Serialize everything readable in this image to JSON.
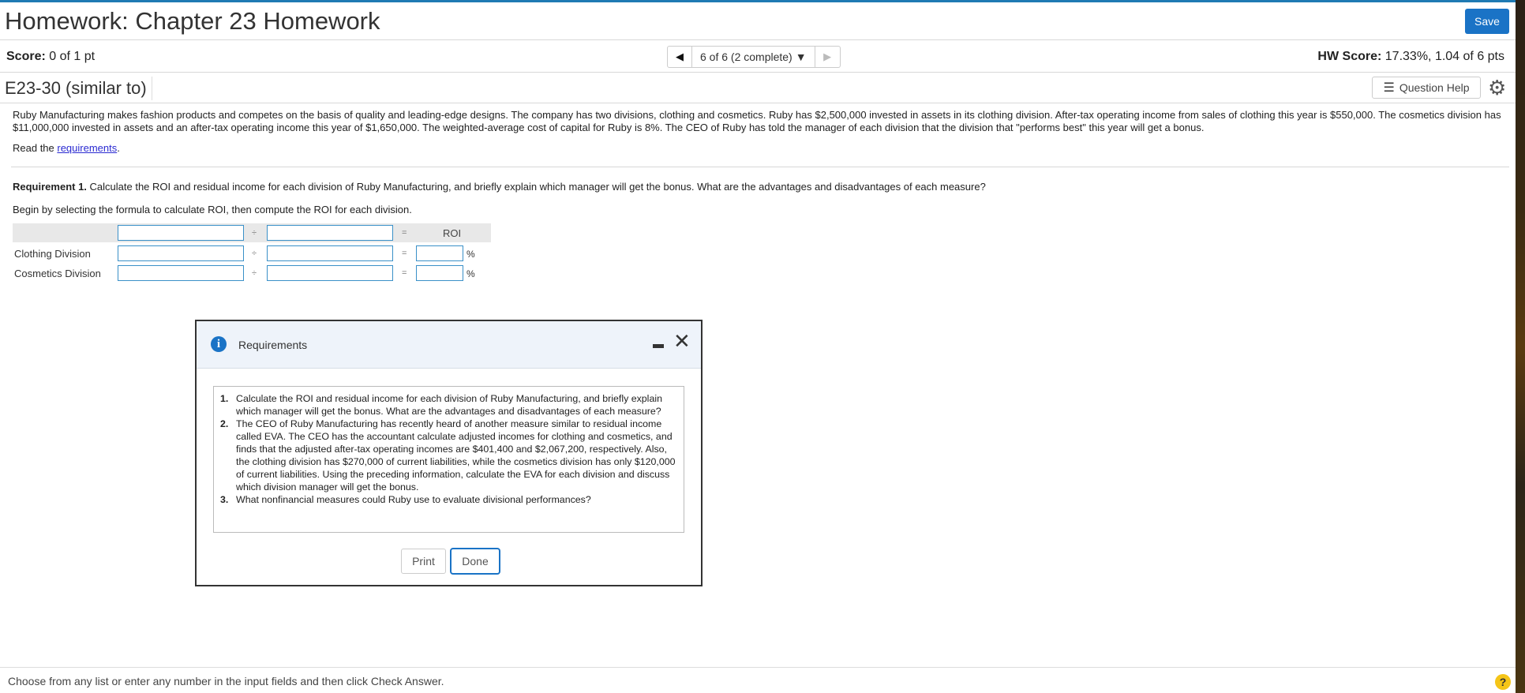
{
  "header": {
    "title": "Homework: Chapter 23 Homework",
    "save_label": "Save"
  },
  "scorebar": {
    "score_label": "Score:",
    "score_value": "0 of 1 pt",
    "nav_position": "6 of 6 (2 complete)",
    "hw_score_label": "HW Score:",
    "hw_score_value": "17.33%, 1.04 of 6 pts"
  },
  "question": {
    "id": "E23-30 (similar to)",
    "help_label": "Question Help"
  },
  "problem": {
    "text": "Ruby Manufacturing makes fashion products and competes on the basis of quality and leading-edge designs. The company has two divisions, clothing and cosmetics. Ruby has $2,500,000 invested in assets in its clothing division. After-tax operating income from sales of clothing this year is $550,000. The cosmetics division has $11,000,000 invested in assets and an after-tax operating income this year of $1,650,000. The weighted-average cost of capital for Ruby is 8%. The CEO of Ruby has told the manager of each division that the division that \"performs best\" this year will get a bonus.",
    "read_prefix": "Read the ",
    "read_link": "requirements",
    "read_suffix": "."
  },
  "requirement1": {
    "label": "Requirement 1.",
    "text": " Calculate the ROI and residual income for each division of Ruby Manufacturing, and briefly explain which manager will get the bonus. What are the advantages and disadvantages of each measure?",
    "begin": "Begin by selecting the formula to calculate ROI, then compute the ROI for each division."
  },
  "grid": {
    "divide_symbol": "÷",
    "equals_symbol": "=",
    "roi_header": "ROI",
    "percent": "%",
    "rows": [
      {
        "label": "Clothing Division"
      },
      {
        "label": "Cosmetics Division"
      }
    ]
  },
  "modal": {
    "title": "Requirements",
    "items": [
      {
        "num": "1.",
        "text": "Calculate the ROI and residual income for each division of Ruby Manufacturing, and briefly explain which manager will get the bonus. What are the advantages and disadvantages of each measure?"
      },
      {
        "num": "2.",
        "text": "The CEO of Ruby Manufacturing has recently heard of another measure similar to residual income called EVA. The CEO has the accountant calculate adjusted incomes for clothing and cosmetics, and finds that the adjusted after-tax operating incomes are $401,400 and $2,067,200, respectively. Also, the clothing division has $270,000 of current liabilities, while the cosmetics division has only $120,000 of current liabilities. Using the preceding information, calculate the EVA for each division and discuss which division manager will get the bonus."
      },
      {
        "num": "3.",
        "text": "What nonfinancial measures could Ruby use to evaluate divisional performances?"
      }
    ],
    "print_label": "Print",
    "done_label": "Done"
  },
  "footer": {
    "text": "Choose from any list or enter any number in the input fields and then click Check Answer.",
    "help_glyph": "?"
  },
  "icons": {
    "prev": "◀",
    "next": "▶",
    "dropdown": "▼",
    "info": "i",
    "close": "✕",
    "gear": "⚙",
    "list": "☰"
  }
}
